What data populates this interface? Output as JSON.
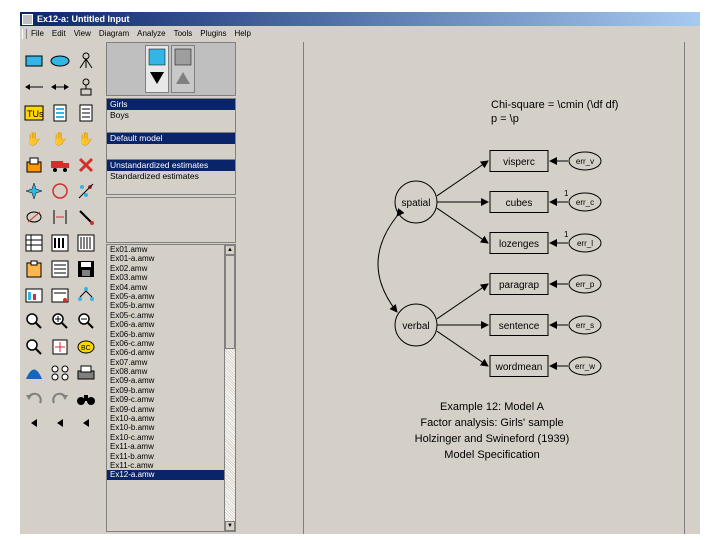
{
  "window": {
    "title": "Ex12-a: Untitled Input",
    "menu": [
      "File",
      "Edit",
      "View",
      "Diagram",
      "Analyze",
      "Tools",
      "Plugins",
      "Help"
    ]
  },
  "groups": {
    "items": [
      {
        "label": "Girls",
        "selected": true
      },
      {
        "label": "Boys",
        "selected": false
      }
    ]
  },
  "models": {
    "items": [
      {
        "label": "Default model",
        "selected": true
      }
    ]
  },
  "estimates": {
    "items": [
      {
        "label": "Unstandardized estimates",
        "selected": true
      },
      {
        "label": "Standardized estimates",
        "selected": false
      }
    ]
  },
  "files": {
    "items": [
      "Ex01.amw",
      "Ex01-a.amw",
      "Ex02.amw",
      "Ex03.amw",
      "Ex04.amw",
      "Ex05-a.amw",
      "Ex05-b.amw",
      "Ex05-c.amw",
      "Ex06-a.amw",
      "Ex06-b.amw",
      "Ex06-c.amw",
      "Ex06-d.amw",
      "Ex07.amw",
      "Ex08.amw",
      "Ex09-a.amw",
      "Ex09-b.amw",
      "Ex09-c.amw",
      "Ex09-d.amw",
      "Ex10-a.amw",
      "Ex10-b.amw",
      "Ex10-c.amw",
      "Ex11-a.amw",
      "Ex11-b.amw",
      "Ex11-c.amw",
      "Ex12-a.amw"
    ]
  },
  "diagram": {
    "stats_line1": "Chi-square = \\cmin (\\df df)",
    "stats_line2": "p = \\p",
    "latent": {
      "spatial": "spatial",
      "verbal": "verbal"
    },
    "indicators": [
      "visperc",
      "cubes",
      "lozenges",
      "paragrap",
      "sentence",
      "wordmean"
    ],
    "errors": [
      "err_v",
      "err_c",
      "err_l",
      "err_p",
      "err_s",
      "err_w"
    ],
    "one": "1",
    "caption": [
      "Example 12: Model A",
      "Factor analysis: Girls' sample",
      "Holzinger and Swineford (1939)",
      "Model Specification"
    ]
  },
  "colors": {
    "titlebar": "#0a246a",
    "selection": "#0a246a",
    "background": "#d4d0c8"
  }
}
